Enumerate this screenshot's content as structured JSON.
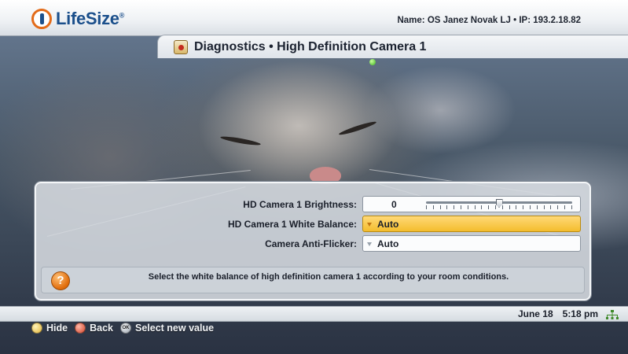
{
  "header": {
    "logo_text": "LifeSize",
    "logo_reg": "®",
    "system_info": "Name: OS Janez Novak LJ • IP: 193.2.18.82"
  },
  "title": {
    "text": "Diagnostics • High Definition Camera 1",
    "icon": "diagnostics-icon"
  },
  "settings": [
    {
      "label": "HD Camera 1 Brightness:",
      "type": "slider",
      "value": "0",
      "slider_fraction": 0.5
    },
    {
      "label": "HD Camera 1 White Balance:",
      "type": "select",
      "value": "Auto",
      "selected": true
    },
    {
      "label": "Camera Anti-Flicker:",
      "type": "select",
      "value": "Auto",
      "selected": false
    }
  ],
  "help": {
    "icon_text": "?",
    "text": "Select the white balance of high definition camera 1 according to your room conditions."
  },
  "status": {
    "date": "June 18",
    "time": "5:18 pm",
    "network_icon": "network-icon"
  },
  "hints": [
    {
      "key": "yellow",
      "label": "Hide"
    },
    {
      "key": "red",
      "label": "Back"
    },
    {
      "key_text": "OK",
      "label": "Select new value"
    }
  ],
  "colors": {
    "brand_blue": "#1b4f8b",
    "brand_orange": "#e36b19",
    "highlight": "#f4bd2d"
  }
}
